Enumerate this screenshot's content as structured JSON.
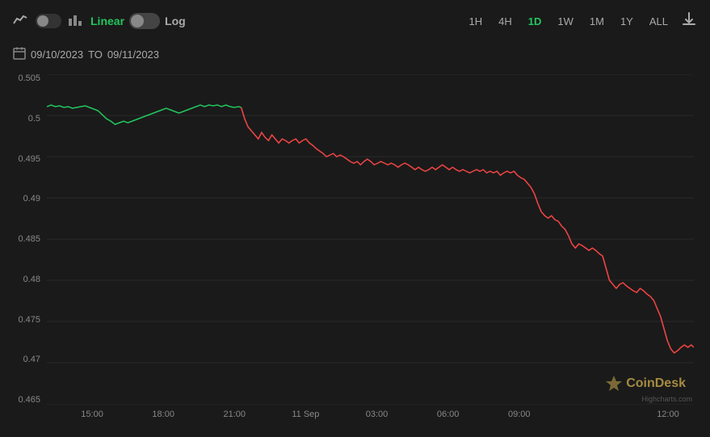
{
  "toolbar": {
    "chart_type_line_icon": "📈",
    "chart_type_bar_icon": "📊",
    "toggle_linear_label": "Linear",
    "toggle_log_label": "Log",
    "time_buttons": [
      "1H",
      "4H",
      "1D",
      "1W",
      "1M",
      "1Y",
      "ALL"
    ],
    "active_time": "1D",
    "download_icon": "⬇"
  },
  "date_bar": {
    "calendar_icon": "📅",
    "from_date": "09/10/2023",
    "to_label": "TO",
    "to_date": "09/11/2023"
  },
  "chart": {
    "y_labels": [
      "0.505",
      "0.5",
      "0.495",
      "0.49",
      "0.485",
      "0.48",
      "0.475",
      "0.47",
      "0.465"
    ],
    "x_labels": [
      {
        "label": "15:00",
        "pct": 7
      },
      {
        "label": "18:00",
        "pct": 18
      },
      {
        "label": "21:00",
        "pct": 29
      },
      {
        "label": "11 Sep",
        "pct": 40
      },
      {
        "label": "03:00",
        "pct": 51
      },
      {
        "label": "06:00",
        "pct": 62
      },
      {
        "label": "09:00",
        "pct": 73
      },
      {
        "label": "12:00",
        "pct": 96
      }
    ],
    "coindesk_label": "CoinDesk",
    "highcharts_credit": "Highcharts.com",
    "colors": {
      "green_line": "#22c55e",
      "red_line": "#ef4444",
      "grid": "#2a2a2a",
      "background": "#1a1a1a"
    }
  }
}
